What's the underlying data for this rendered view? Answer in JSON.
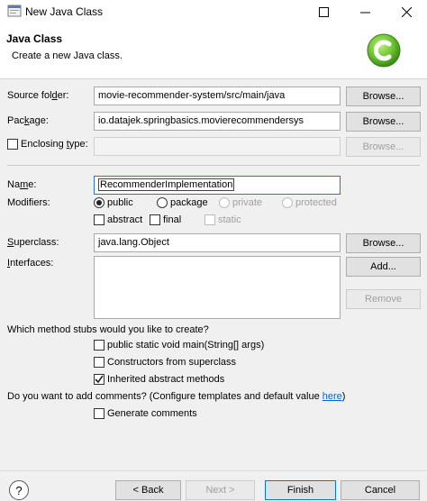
{
  "window": {
    "title": "New Java Class"
  },
  "header": {
    "title": "Java Class",
    "description": "Create a new Java class."
  },
  "fields": {
    "source_folder": {
      "label_a": "Source fol",
      "label_mn": "d",
      "label_b": "er:",
      "value": "movie-recommender-system/src/main/java"
    },
    "package": {
      "label_a": "Pac",
      "label_mn": "k",
      "label_b": "age:",
      "value": "io.datajek.springbasics.movierecommendersys"
    },
    "enclosing": {
      "label_a": "Enclosing ",
      "label_mn": "t",
      "label_b": "ype:",
      "value": ""
    },
    "name": {
      "label_a": "Na",
      "label_mn": "m",
      "label_b": "e:",
      "value": "RecommenderImplementation"
    },
    "superclass": {
      "label_a": "",
      "label_mn": "S",
      "label_b": "uperclass:",
      "value": "java.lang.Object"
    },
    "interfaces": {
      "label_a": "",
      "label_mn": "I",
      "label_b": "nterfaces:"
    }
  },
  "buttons": {
    "browse": "Browse...",
    "add": "Add...",
    "remove": "Remove",
    "help": "?",
    "back": "< Back",
    "next": "Next >",
    "finish": "Finish",
    "cancel": "Cancel"
  },
  "modifiers": {
    "label": "Modifiers:",
    "public": "public",
    "package": "package",
    "private": "private",
    "protected": "protected",
    "abstract": "abstract",
    "final": "final",
    "static": "static"
  },
  "stubs": {
    "question": "Which method stubs would you like to create?",
    "main": "public static void main(String[] args)",
    "constructors": "Constructors from superclass",
    "inherited": "Inherited abstract methods"
  },
  "comments": {
    "question": "Do you want to add comments? (Configure templates and default value ",
    "link": "here",
    "close": ")",
    "generate": "Generate comments"
  },
  "colors": {
    "accent": "#0078d7",
    "logo_green": "#6cc231",
    "link": "#0066cc"
  }
}
